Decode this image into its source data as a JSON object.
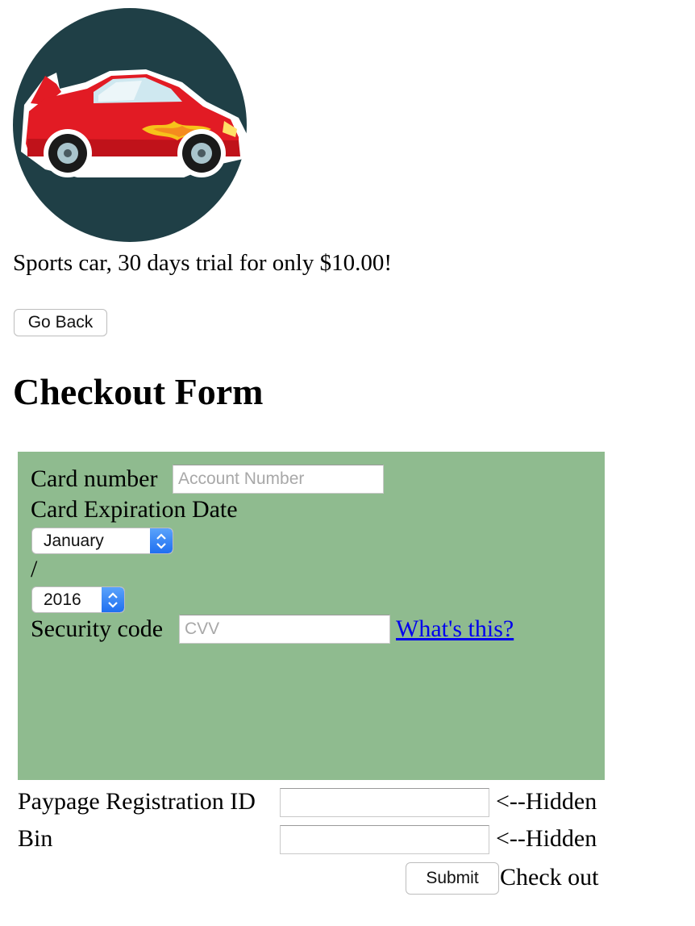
{
  "product": {
    "logo_icon": "sports-car-icon",
    "tagline": "Sports car, 30 days trial for only $10.00!"
  },
  "nav": {
    "back_label": "Go Back"
  },
  "page": {
    "title": "Checkout Form"
  },
  "card_form": {
    "card_number_label": "Card number",
    "card_number_placeholder": "Account Number",
    "expiration_label": "Card Expiration Date",
    "month_selected": "January",
    "separator": "/",
    "year_selected": "2016",
    "security_label": "Security code",
    "security_placeholder": "CVV",
    "whats_this_link": "What's this?"
  },
  "hidden_fields": {
    "paypage_label": "Paypage Registration ID",
    "paypage_note": "<--Hidden",
    "bin_label": "Bin",
    "bin_note": "<--Hidden"
  },
  "submit": {
    "button_label": "Submit",
    "caption": "Check out"
  },
  "colors": {
    "panel_bg": "#8fbb8f",
    "logo_bg": "#1f3f46",
    "car_body": "#e21b24",
    "link": "#0000ee",
    "select_arrow": "#2a7cf6"
  }
}
